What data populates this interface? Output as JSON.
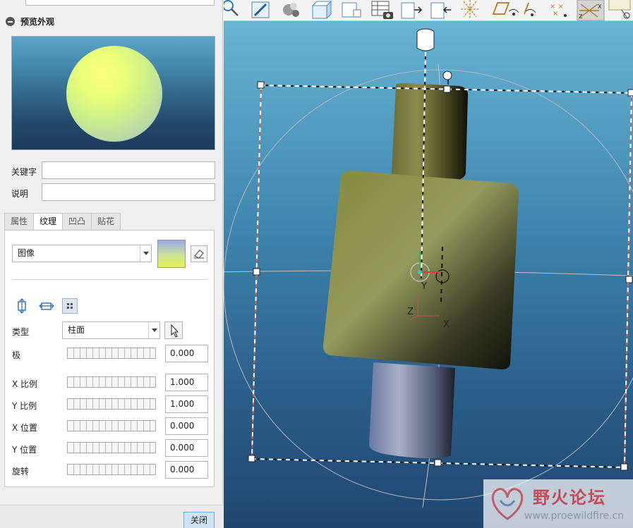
{
  "panel": {
    "section_title": "预览外观",
    "keyword_label": "关键字",
    "keyword_value": "",
    "description_label": "说明",
    "description_value": "",
    "tabs": [
      {
        "label": "属性"
      },
      {
        "label": "纹理"
      },
      {
        "label": "凹凸"
      },
      {
        "label": "贴花"
      }
    ],
    "active_tab": "纹理",
    "texture_source": "图像",
    "type_label": "类型",
    "type_value": "柱面",
    "rows": [
      {
        "label": "极",
        "value": "0.000"
      },
      {
        "label": "X 比例",
        "value": "1.000"
      },
      {
        "label": "Y 比例",
        "value": "1.000"
      },
      {
        "label": "X 位置",
        "value": "0.000"
      },
      {
        "label": "Y 位置",
        "value": "0.000"
      },
      {
        "label": "旋转",
        "value": "0.000"
      }
    ],
    "close_label": "关闭"
  },
  "viewport": {
    "axis_labels": {
      "y": "Y",
      "z": "Z",
      "x": "X"
    }
  },
  "toolbar_icons": [
    "zoom-icon",
    "sketch-icon",
    "spheres-icon",
    "view-cube-icon",
    "saved-views-icon",
    "table-icon",
    "camera-icon",
    "view-forward-icon",
    "view-back-icon",
    "datum-axis-display-icon",
    "datum-plane-display-icon",
    "datum-point-display-icon",
    "datum-point-x-display-icon",
    "csys-display-icon",
    "annotation-display-icon"
  ],
  "watermark": {
    "title": "野火论坛",
    "url": "www.proewildfire.cn"
  },
  "colors": {
    "accent": "#cfe3f5",
    "viewport_top": "#68b4d4",
    "viewport_bottom": "#1f4670",
    "model": "#8a8a3c"
  }
}
